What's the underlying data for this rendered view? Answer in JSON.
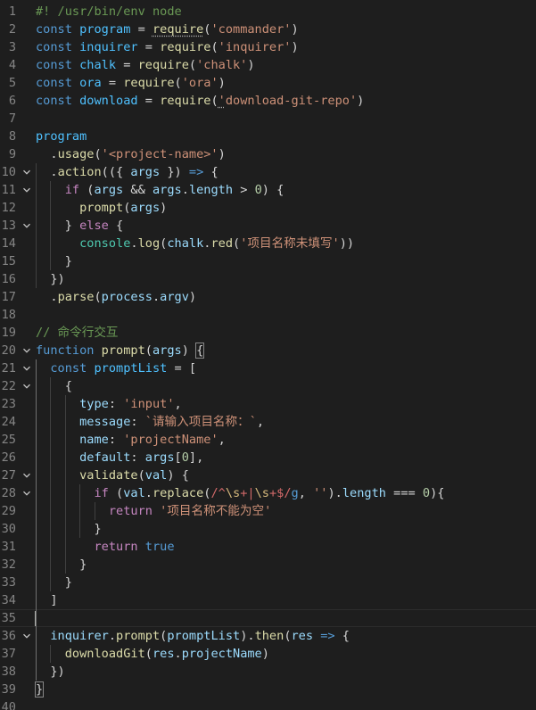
{
  "editor": {
    "language": "javascript",
    "cursor_line": 35,
    "lines": [
      {
        "n": "1",
        "fold": false,
        "tokens": [
          [
            "cm",
            "#! /usr/bin/env node"
          ]
        ]
      },
      {
        "n": "2",
        "fold": false,
        "tokens": [
          [
            "kw",
            "const"
          ],
          [
            "op",
            " "
          ],
          [
            "const",
            "program"
          ],
          [
            "op",
            " = "
          ],
          [
            "fn",
            "require",
            "sq"
          ],
          [
            "op",
            "("
          ],
          [
            "str",
            "'commander'"
          ],
          [
            "op",
            ")"
          ]
        ]
      },
      {
        "n": "3",
        "fold": false,
        "tokens": [
          [
            "kw",
            "const"
          ],
          [
            "op",
            " "
          ],
          [
            "const",
            "inquirer"
          ],
          [
            "op",
            " = "
          ],
          [
            "fn",
            "require"
          ],
          [
            "op",
            "("
          ],
          [
            "str",
            "'inquirer'"
          ],
          [
            "op",
            ")"
          ]
        ]
      },
      {
        "n": "4",
        "fold": false,
        "tokens": [
          [
            "kw",
            "const"
          ],
          [
            "op",
            " "
          ],
          [
            "const",
            "chalk"
          ],
          [
            "op",
            " = "
          ],
          [
            "fn",
            "require"
          ],
          [
            "op",
            "("
          ],
          [
            "str",
            "'chalk'"
          ],
          [
            "op",
            ")"
          ]
        ]
      },
      {
        "n": "5",
        "fold": false,
        "tokens": [
          [
            "kw",
            "const"
          ],
          [
            "op",
            " "
          ],
          [
            "const",
            "ora"
          ],
          [
            "op",
            " = "
          ],
          [
            "fn",
            "require"
          ],
          [
            "op",
            "("
          ],
          [
            "str",
            "'ora'"
          ],
          [
            "op",
            ")"
          ]
        ]
      },
      {
        "n": "6",
        "fold": false,
        "tokens": [
          [
            "kw",
            "const"
          ],
          [
            "op",
            " "
          ],
          [
            "const",
            "download"
          ],
          [
            "op",
            " = "
          ],
          [
            "fn",
            "require"
          ],
          [
            "op",
            "("
          ],
          [
            "str",
            "'",
            "sq"
          ],
          [
            "str",
            "download-git-repo'"
          ],
          [
            "op",
            ")"
          ]
        ]
      },
      {
        "n": "7",
        "fold": false,
        "tokens": []
      },
      {
        "n": "8",
        "fold": false,
        "tokens": [
          [
            "const",
            "program"
          ]
        ]
      },
      {
        "n": "9",
        "fold": false,
        "tokens": [
          [
            "op",
            "  ."
          ],
          [
            "fn",
            "usage"
          ],
          [
            "op",
            "("
          ],
          [
            "str",
            "'<project-name>'"
          ],
          [
            "op",
            ")"
          ]
        ]
      },
      {
        "n": "10",
        "fold": true,
        "tokens": [
          [
            "op",
            "  ."
          ],
          [
            "fn",
            "action"
          ],
          [
            "op",
            "(({ "
          ],
          [
            "var",
            "args"
          ],
          [
            "op",
            " }) "
          ],
          [
            "kw",
            "=>"
          ],
          [
            "op",
            " {"
          ]
        ]
      },
      {
        "n": "11",
        "fold": true,
        "tokens": [
          [
            "op",
            "    "
          ],
          [
            "ctl",
            "if"
          ],
          [
            "op",
            " ("
          ],
          [
            "var",
            "args"
          ],
          [
            "op",
            " && "
          ],
          [
            "var",
            "args"
          ],
          [
            "op",
            "."
          ],
          [
            "var",
            "length"
          ],
          [
            "op",
            " > "
          ],
          [
            "num",
            "0"
          ],
          [
            "op",
            ") {"
          ]
        ]
      },
      {
        "n": "12",
        "fold": false,
        "tokens": [
          [
            "op",
            "      "
          ],
          [
            "fn",
            "prompt"
          ],
          [
            "op",
            "("
          ],
          [
            "var",
            "args"
          ],
          [
            "op",
            ")"
          ]
        ]
      },
      {
        "n": "13",
        "fold": true,
        "tokens": [
          [
            "op",
            "    } "
          ],
          [
            "ctl",
            "else"
          ],
          [
            "op",
            " {"
          ]
        ]
      },
      {
        "n": "14",
        "fold": false,
        "tokens": [
          [
            "op",
            "      "
          ],
          [
            "cls",
            "console"
          ],
          [
            "op",
            "."
          ],
          [
            "fn",
            "log"
          ],
          [
            "op",
            "("
          ],
          [
            "var",
            "chalk"
          ],
          [
            "op",
            "."
          ],
          [
            "fn",
            "red"
          ],
          [
            "op",
            "("
          ],
          [
            "str",
            "'项目名称未填写'"
          ],
          [
            "op",
            "))"
          ]
        ]
      },
      {
        "n": "15",
        "fold": false,
        "tokens": [
          [
            "op",
            "    }"
          ]
        ]
      },
      {
        "n": "16",
        "fold": false,
        "tokens": [
          [
            "op",
            "  })"
          ]
        ]
      },
      {
        "n": "17",
        "fold": false,
        "tokens": [
          [
            "op",
            "  ."
          ],
          [
            "fn",
            "parse"
          ],
          [
            "op",
            "("
          ],
          [
            "var",
            "process"
          ],
          [
            "op",
            "."
          ],
          [
            "var",
            "argv"
          ],
          [
            "op",
            ")"
          ]
        ]
      },
      {
        "n": "18",
        "fold": false,
        "tokens": []
      },
      {
        "n": "19",
        "fold": false,
        "tokens": [
          [
            "cm",
            "// 命令行交互"
          ]
        ]
      },
      {
        "n": "20",
        "fold": true,
        "tokens": [
          [
            "kw",
            "function"
          ],
          [
            "op",
            " "
          ],
          [
            "fn",
            "prompt"
          ],
          [
            "op",
            "("
          ],
          [
            "var",
            "args"
          ],
          [
            "op",
            ") "
          ],
          [
            "op",
            "{",
            "box"
          ]
        ]
      },
      {
        "n": "21",
        "fold": true,
        "tokens": [
          [
            "op",
            "  "
          ],
          [
            "kw",
            "const"
          ],
          [
            "op",
            " "
          ],
          [
            "const",
            "promptList"
          ],
          [
            "op",
            " = ["
          ]
        ]
      },
      {
        "n": "22",
        "fold": true,
        "tokens": [
          [
            "op",
            "    {"
          ]
        ]
      },
      {
        "n": "23",
        "fold": false,
        "tokens": [
          [
            "op",
            "      "
          ],
          [
            "var",
            "type"
          ],
          [
            "op",
            ": "
          ],
          [
            "str",
            "'input'"
          ],
          [
            "op",
            ","
          ]
        ]
      },
      {
        "n": "24",
        "fold": false,
        "tokens": [
          [
            "op",
            "      "
          ],
          [
            "var",
            "message"
          ],
          [
            "op",
            ": "
          ],
          [
            "str",
            "`请输入项目名称：`"
          ],
          [
            "op",
            ","
          ]
        ]
      },
      {
        "n": "25",
        "fold": false,
        "tokens": [
          [
            "op",
            "      "
          ],
          [
            "var",
            "name"
          ],
          [
            "op",
            ": "
          ],
          [
            "str",
            "'projectName'"
          ],
          [
            "op",
            ","
          ]
        ]
      },
      {
        "n": "26",
        "fold": false,
        "tokens": [
          [
            "op",
            "      "
          ],
          [
            "var",
            "default"
          ],
          [
            "op",
            ": "
          ],
          [
            "var",
            "args"
          ],
          [
            "op",
            "["
          ],
          [
            "num",
            "0"
          ],
          [
            "op",
            "],"
          ]
        ]
      },
      {
        "n": "27",
        "fold": true,
        "tokens": [
          [
            "op",
            "      "
          ],
          [
            "fn",
            "validate"
          ],
          [
            "op",
            "("
          ],
          [
            "var",
            "val"
          ],
          [
            "op",
            ") {"
          ]
        ]
      },
      {
        "n": "28",
        "fold": true,
        "tokens": [
          [
            "op",
            "        "
          ],
          [
            "ctl",
            "if"
          ],
          [
            "op",
            " ("
          ],
          [
            "var",
            "val"
          ],
          [
            "op",
            "."
          ],
          [
            "fn",
            "replace"
          ],
          [
            "op",
            "("
          ],
          [
            "re",
            "/^"
          ],
          [
            "reesc",
            "\\s"
          ],
          [
            "re",
            "+"
          ],
          [
            "re",
            "|"
          ],
          [
            "reesc",
            "\\s"
          ],
          [
            "re",
            "+$/"
          ],
          [
            "kw",
            "g"
          ],
          [
            "op",
            ", "
          ],
          [
            "str",
            "''"
          ],
          [
            "op",
            ")."
          ],
          [
            "var",
            "length"
          ],
          [
            "op",
            " === "
          ],
          [
            "num",
            "0"
          ],
          [
            "op",
            "){"
          ]
        ]
      },
      {
        "n": "29",
        "fold": false,
        "tokens": [
          [
            "op",
            "          "
          ],
          [
            "ctl",
            "return"
          ],
          [
            "op",
            " "
          ],
          [
            "str",
            "'项目名称不能为空'"
          ]
        ]
      },
      {
        "n": "30",
        "fold": false,
        "tokens": [
          [
            "op",
            "        }"
          ]
        ]
      },
      {
        "n": "31",
        "fold": false,
        "tokens": [
          [
            "op",
            "        "
          ],
          [
            "ctl",
            "return"
          ],
          [
            "op",
            " "
          ],
          [
            "kw",
            "true"
          ]
        ]
      },
      {
        "n": "32",
        "fold": false,
        "tokens": [
          [
            "op",
            "      }"
          ]
        ]
      },
      {
        "n": "33",
        "fold": false,
        "tokens": [
          [
            "op",
            "    }"
          ]
        ]
      },
      {
        "n": "34",
        "fold": false,
        "tokens": [
          [
            "op",
            "  ]"
          ]
        ]
      },
      {
        "n": "35",
        "fold": false,
        "tokens": []
      },
      {
        "n": "36",
        "fold": true,
        "tokens": [
          [
            "op",
            "  "
          ],
          [
            "var",
            "inquirer"
          ],
          [
            "op",
            "."
          ],
          [
            "fn",
            "prompt"
          ],
          [
            "op",
            "("
          ],
          [
            "var",
            "promptList"
          ],
          [
            "op",
            ")."
          ],
          [
            "fn",
            "then"
          ],
          [
            "op",
            "("
          ],
          [
            "var",
            "res"
          ],
          [
            "op",
            " "
          ],
          [
            "kw",
            "=>"
          ],
          [
            "op",
            " {"
          ]
        ]
      },
      {
        "n": "37",
        "fold": false,
        "tokens": [
          [
            "op",
            "    "
          ],
          [
            "fn",
            "downloadGit"
          ],
          [
            "op",
            "("
          ],
          [
            "var",
            "res"
          ],
          [
            "op",
            "."
          ],
          [
            "var",
            "projectName"
          ],
          [
            "op",
            ")"
          ]
        ]
      },
      {
        "n": "38",
        "fold": false,
        "tokens": [
          [
            "op",
            "  })"
          ]
        ]
      },
      {
        "n": "39",
        "fold": false,
        "tokens": [
          [
            "op",
            "}",
            "box"
          ]
        ]
      },
      {
        "n": "40",
        "fold": false,
        "tokens": []
      }
    ]
  }
}
